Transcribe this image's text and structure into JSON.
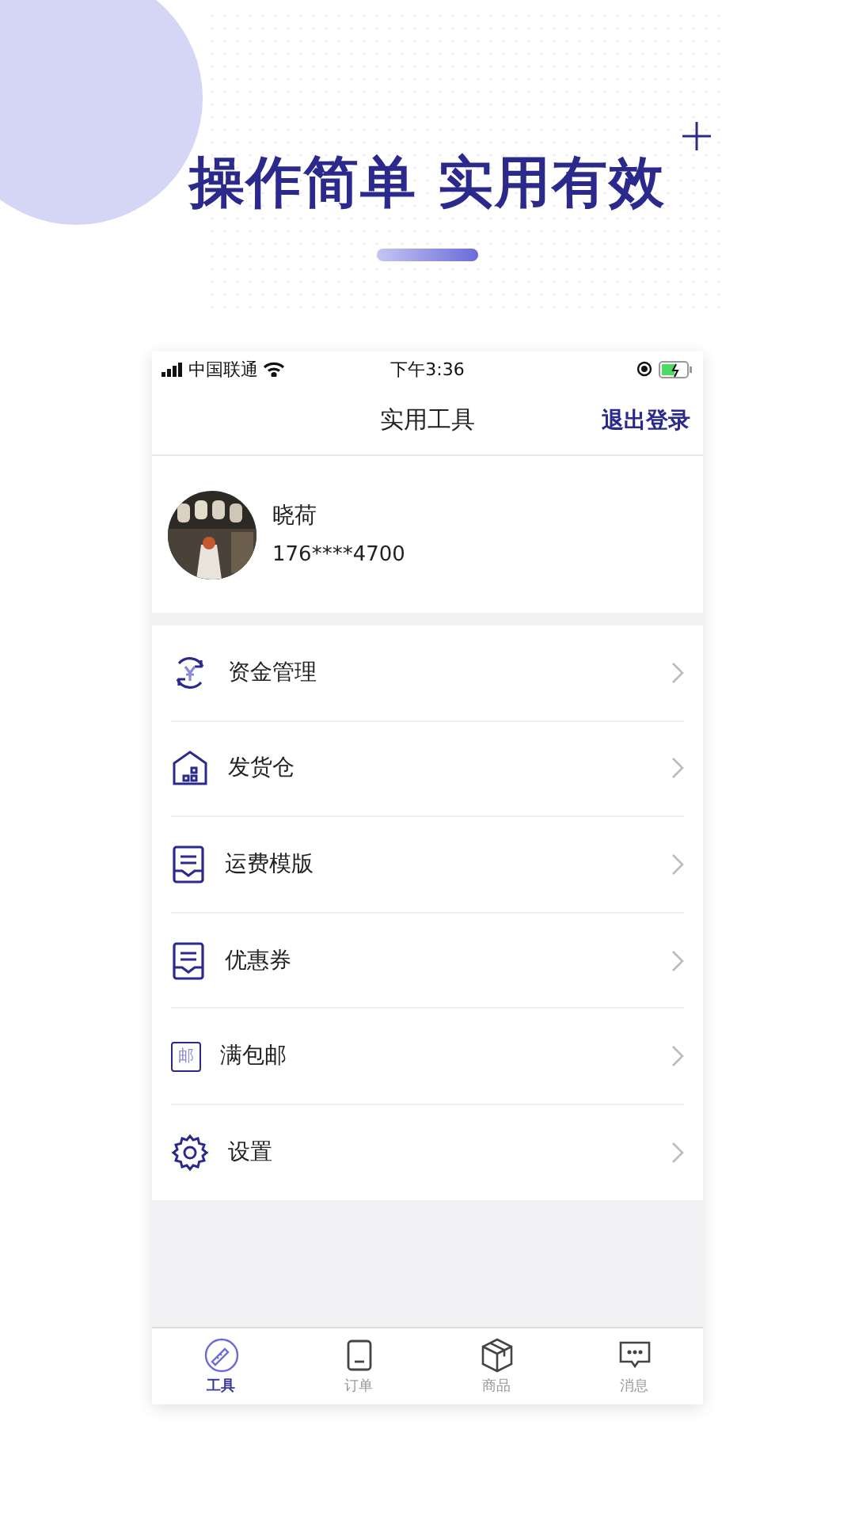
{
  "headline": "操作简单 实用有效",
  "status_bar": {
    "carrier": "中国联通",
    "time": "下午3:36"
  },
  "nav": {
    "title": "实用工具",
    "action": "退出登录"
  },
  "profile": {
    "name": "晓荷",
    "phone": "176****4700"
  },
  "menu": [
    {
      "label": "资金管理",
      "kind": "money"
    },
    {
      "label": "发货仓",
      "kind": "warehouse"
    },
    {
      "label": "运费模版",
      "kind": "tray"
    },
    {
      "label": "优惠券",
      "kind": "tray"
    },
    {
      "label": "满包邮",
      "kind": "stamp",
      "icon_text": "邮"
    },
    {
      "label": "设置",
      "kind": "settings"
    }
  ],
  "tab_bar": [
    {
      "label": "工具",
      "kind": "tools",
      "selected": true
    },
    {
      "label": "订单",
      "kind": "orders",
      "selected": false
    },
    {
      "label": "商品",
      "kind": "goods",
      "selected": false
    },
    {
      "label": "消息",
      "kind": "messages",
      "selected": false
    }
  ]
}
